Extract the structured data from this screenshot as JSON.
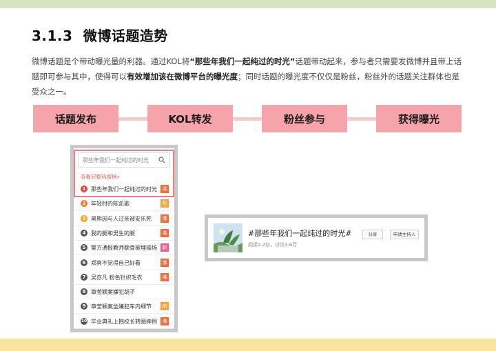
{
  "section": {
    "number": "3.1.3",
    "title": "微博话题造势"
  },
  "paragraph": {
    "p1": "微博话题是个带动曝光量的利器。通过KOL将",
    "quote": "“那些年我们一起纯过的时光”",
    "p2": "话题带动起来，参与者只需要发微博并且带上话题即可参与其中，使得可以",
    "bold": "有效增加该在微博平台的曝光度",
    "p3": "；同时话题的曝光度不仅仅是粉丝，粉丝外的话题关注群体也是受众之一。"
  },
  "flow": [
    "话题发布",
    "KOL转发",
    "粉丝参与",
    "获得曝光"
  ],
  "hot_list": {
    "search_text": "那些年我们一起纯过的时光",
    "see_all": "查看完整热搜榜»",
    "items": [
      {
        "rank": "1",
        "text": "那些年我们一起纯过的时光",
        "tag": "沸"
      },
      {
        "rank": "2",
        "text": "年轻时的陈凯歌",
        "tag": "热"
      },
      {
        "rank": "3",
        "text": "黑熊因与人过亲被安乐死",
        "tag": "沸"
      },
      {
        "rank": "4",
        "text": "我的腿和男生的腿",
        "tag": "沸"
      },
      {
        "rank": "5",
        "text": "警方通报教师额骨被埋操场",
        "tag": "新"
      },
      {
        "rank": "6",
        "text": "郑爽不觉得自己好看",
        "tag": "沸"
      },
      {
        "rank": "7",
        "text": "吴亦凡 粉色针织毛衣",
        "tag": "沸"
      },
      {
        "rank": "8",
        "text": "章莹颖案嫌犯胡子",
        "tag": ""
      },
      {
        "rank": "9",
        "text": "章莹颖案坐嫌犯车内细节",
        "tag": "热"
      },
      {
        "rank": "10",
        "text": "毕业典礼上抱校长转圈摔倒",
        "tag": "沸"
      }
    ]
  },
  "topic_card": {
    "title": "#那些年我们一起纯过的时光#",
    "stats": "阅读2.2亿，讨论1.6万",
    "share": "分享",
    "host": "申请主持人"
  },
  "colors": {
    "flow_box": "#f6a4ab",
    "flow_line": "#f7c9cd",
    "highlight": "#f07c84",
    "tag_hot": "#f7a23a",
    "tag_boil": "#f26b3a",
    "tag_new": "#f25a88",
    "rank_top": "#e8453c",
    "rank_second": "#f07a30",
    "rank_third": "#f5a623",
    "rank_other": "#555555"
  }
}
